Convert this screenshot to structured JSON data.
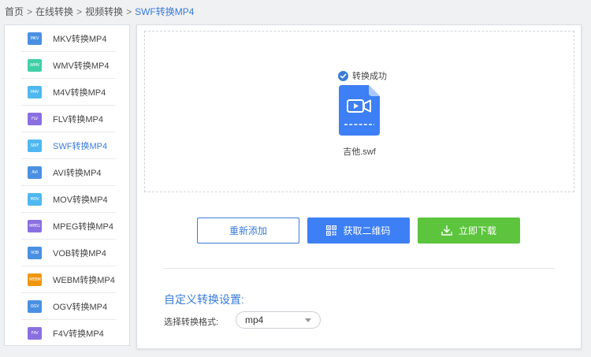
{
  "breadcrumb": {
    "items": [
      "首页",
      "在线转换",
      "视频转换",
      "SWF转换MP4"
    ],
    "separator": ">"
  },
  "sidebar": {
    "items": [
      {
        "label": "MKV转换MP4",
        "badge": "MKV",
        "color": "#4a90e2",
        "active": false
      },
      {
        "label": "WMV转换MP4",
        "badge": "WMV",
        "color": "#3fcfa7",
        "active": false
      },
      {
        "label": "M4V转换MP4",
        "badge": "M4V",
        "color": "#4fb8f0",
        "active": false
      },
      {
        "label": "FLV转换MP4",
        "badge": "FLV",
        "color": "#8a6fe0",
        "active": false
      },
      {
        "label": "SWF转换MP4",
        "badge": "SWF",
        "color": "#4fb8f0",
        "active": true
      },
      {
        "label": "AVI转换MP4",
        "badge": "AVI",
        "color": "#4a90e2",
        "active": false
      },
      {
        "label": "MOV转换MP4",
        "badge": "MOV",
        "color": "#4fb8f0",
        "active": false
      },
      {
        "label": "MPEG转换MP4",
        "badge": "MPEG",
        "color": "#8a6fe0",
        "active": false
      },
      {
        "label": "VOB转换MP4",
        "badge": "VOB",
        "color": "#4a90e2",
        "active": false
      },
      {
        "label": "WEBM转换MP4",
        "badge": "WEBM",
        "color": "#f0960e",
        "active": false
      },
      {
        "label": "OGV转换MP4",
        "badge": "OGV",
        "color": "#4a90e2",
        "active": false
      },
      {
        "label": "F4V转换MP4",
        "badge": "F4V",
        "color": "#8a6fe0",
        "active": false
      }
    ]
  },
  "main": {
    "status_text": "转换成功",
    "file_name": "吉他.swf",
    "buttons": {
      "readd": "重新添加",
      "qrcode": "获取二维码",
      "download": "立即下载"
    },
    "settings": {
      "title": "自定义转换设置:",
      "format_label": "选择转换格式:",
      "format_value": "mp4"
    }
  },
  "colors": {
    "accent": "#3a7cd8",
    "qr_button": "#3d7ff4",
    "download_button": "#5cc53d"
  }
}
